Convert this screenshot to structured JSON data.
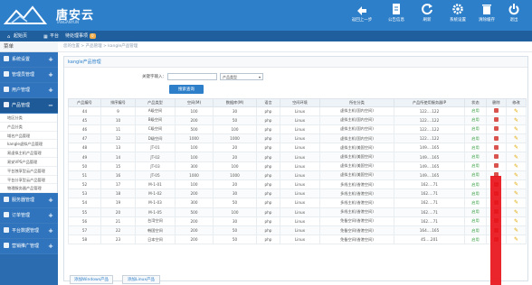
{
  "header": {
    "logo_text": "唐安云",
    "logo_sub": "TANGANYUN",
    "buttons": [
      {
        "label": "返回上一步",
        "icon": "back-arrow-icon"
      },
      {
        "label": "公告信息",
        "icon": "document-icon"
      },
      {
        "label": "刷新",
        "icon": "refresh-icon"
      },
      {
        "label": "系统设置",
        "icon": "gear-icon"
      },
      {
        "label": "清除缓存",
        "icon": "trash-icon"
      },
      {
        "label": "退出",
        "icon": "power-icon"
      }
    ]
  },
  "navbar": {
    "home": "起始页",
    "platform": "平台",
    "pending": "待处理事项",
    "pending_count": "0"
  },
  "sidebar": {
    "heading": "菜单",
    "groups": [
      {
        "label": "系统设置"
      },
      {
        "label": "管理员管理"
      },
      {
        "label": "用户管理"
      },
      {
        "label": "产品管理"
      }
    ],
    "sub_items": [
      "地区分类",
      "产品分类",
      "域名产品管理",
      "kangle虚拟产品管理",
      "易虚拟主机产品管理",
      "易安VPS产品管理",
      "平台独享型云产品管理",
      "平台分享型云产品管理",
      "物理服务器产品管理"
    ],
    "groups_after": [
      {
        "label": "服务器管理"
      },
      {
        "label": "订单管理"
      },
      {
        "label": "平台数据管理"
      },
      {
        "label": "营销推广管理"
      }
    ]
  },
  "main": {
    "breadcrumb": "您的位置 > 产品管理 > kangle产品管理",
    "panel_title": "kangle产品管理",
    "filter_label": "关键字输入：",
    "filter_input_value": "",
    "filter_select": "产品类型",
    "query_button": "搜索查询",
    "columns": [
      "产品编号",
      "排序编号",
      "产品类型",
      "空间(M)",
      "数据库(M)",
      "语言",
      "空间环境",
      "所在分类",
      "产品所使用服务器IP",
      "状态",
      "删除",
      "修改"
    ],
    "rows": [
      [
        "44",
        "9",
        "A级空间",
        "100",
        "30",
        "php",
        "Linux",
        "虚拟主机(国内空间)",
        "122.…122",
        "启用"
      ],
      [
        "45",
        "10",
        "B级空间",
        "200",
        "50",
        "php",
        "Linux",
        "虚拟主机(国内空间)",
        "122.…122",
        "启用"
      ],
      [
        "46",
        "11",
        "C级空间",
        "500",
        "100",
        "php",
        "Linux",
        "虚拟主机(国内空间)",
        "122.…122",
        "启用"
      ],
      [
        "47",
        "12",
        "D级空间",
        "1000",
        "1000",
        "php",
        "Linux",
        "虚拟主机(国内空间)",
        "122.…122",
        "启用"
      ],
      [
        "48",
        "13",
        "JT-01",
        "100",
        "20",
        "php",
        "Linux",
        "虚拟主机(美国空间)",
        "149.…165",
        "启用"
      ],
      [
        "49",
        "14",
        "JT-02",
        "100",
        "20",
        "php",
        "Linux",
        "虚拟主机(美国空间)",
        "149.…165",
        "启用"
      ],
      [
        "50",
        "15",
        "JT-03",
        "300",
        "100",
        "php",
        "Linux",
        "虚拟主机(美国空间)",
        "149.…165",
        "启用"
      ],
      [
        "51",
        "16",
        "JT-05",
        "1000",
        "1000",
        "php",
        "Linux",
        "虚拟主机(美国空间)",
        "149.…165",
        "启用"
      ],
      [
        "52",
        "17",
        "M-1-01",
        "100",
        "20",
        "php",
        "Linux",
        "多线主机(香港空间)",
        "162.…71",
        "启用"
      ],
      [
        "53",
        "18",
        "M-1-02",
        "200",
        "30",
        "php",
        "Linux",
        "多线主机(香港空间)",
        "162.…71",
        "启用"
      ],
      [
        "54",
        "19",
        "M-1-03",
        "300",
        "50",
        "php",
        "Linux",
        "多线主机(香港空间)",
        "162.…71",
        "启用"
      ],
      [
        "55",
        "20",
        "M-1-05",
        "500",
        "100",
        "php",
        "Linux",
        "多线主机(香港空间)",
        "162.…71",
        "启用"
      ],
      [
        "56",
        "21",
        "台湾空间",
        "200",
        "30",
        "php",
        "Linux",
        "免备空间(香港空间)",
        "162.…71",
        "启用"
      ],
      [
        "57",
        "22",
        "韩国空间",
        "200",
        "50",
        "php",
        "Linux",
        "免备空间(香港空间)",
        "164.…165",
        "启用"
      ],
      [
        "58",
        "23",
        "日本空间",
        "200",
        "50",
        "php",
        "Linux",
        "免备空间(香港空间)",
        "45.…201",
        "启用"
      ]
    ],
    "add_windows": "添加Windows产品",
    "add_linux": "添加Linux产品"
  },
  "colors": {
    "header": "#2e7fc9",
    "navbar": "#1f5f9e",
    "sidebar": "#2b6cb0",
    "status": "#2e9b3a",
    "redact": "#e8121a"
  }
}
